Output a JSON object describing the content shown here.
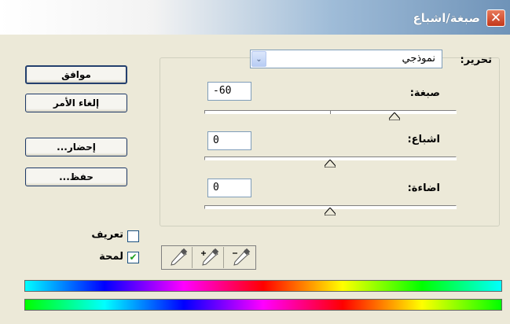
{
  "window": {
    "title": "صبغة/اشباع",
    "close_glyph": "✕"
  },
  "buttons": {
    "ok": "موافق",
    "cancel": "إلغاء الأمر",
    "load": "إحضار...",
    "save": "حفظ..."
  },
  "edit": {
    "label": "تحرير:",
    "value": "نموذجي",
    "dropdown_glyph": "⌄"
  },
  "sliders": [
    {
      "label": "صبغة:",
      "value": "-60",
      "level": -60,
      "min": -180,
      "max": 180
    },
    {
      "label": "اشباع:",
      "value": "0",
      "level": 0,
      "min": -100,
      "max": 100
    },
    {
      "label": "اضاءة:",
      "value": "0",
      "level": 0,
      "min": -100,
      "max": 100
    }
  ],
  "checkboxes": {
    "colorize": {
      "label": "تعريف",
      "checked": false
    },
    "preview": {
      "label": "لمحة",
      "checked": true,
      "mark": "✔"
    }
  },
  "eyedroppers": [
    "eyedropper-icon",
    "eyedropper-plus-icon",
    "eyedropper-minus-icon"
  ],
  "colors": {
    "title_accent": "#6f93b8",
    "check_mark": "#21a121",
    "close": "#c2371a"
  }
}
